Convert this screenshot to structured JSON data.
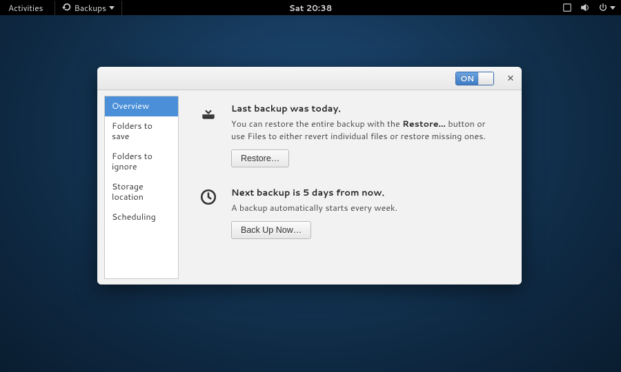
{
  "topbar": {
    "activities": "Activities",
    "appmenu": "Backups",
    "clock": "Sat 20:38"
  },
  "window": {
    "toggle_on": "ON"
  },
  "sidebar": {
    "items": [
      {
        "label": "Overview",
        "selected": true
      },
      {
        "label": "Folders to save",
        "selected": false
      },
      {
        "label": "Folders to ignore",
        "selected": false
      },
      {
        "label": "Storage location",
        "selected": false
      },
      {
        "label": "Scheduling",
        "selected": false
      }
    ]
  },
  "overview": {
    "last_backup": {
      "heading": "Last backup was today.",
      "desc_prefix": "You can restore the entire backup with the ",
      "desc_bold": "Restore…",
      "desc_suffix": " button or use Files to either revert individual files or restore missing ones.",
      "button": "Restore…"
    },
    "next_backup": {
      "heading": "Next backup is 5 days from now.",
      "desc": "A backup automatically starts every week.",
      "button": "Back Up Now…"
    }
  }
}
